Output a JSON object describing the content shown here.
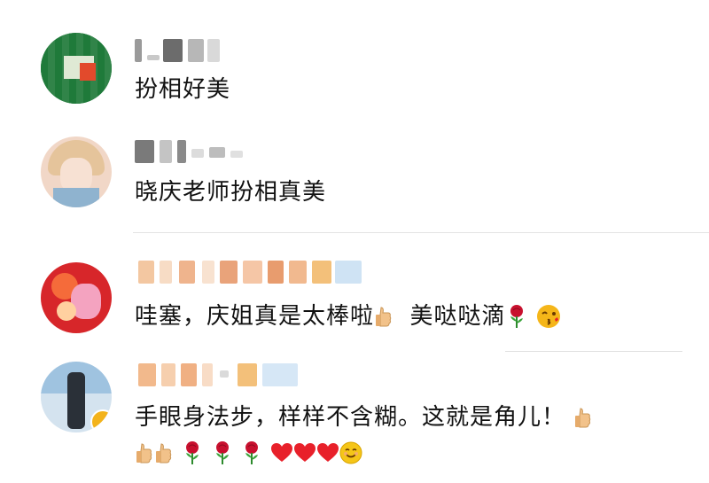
{
  "comments": [
    {
      "id": "c1",
      "name_masked": "",
      "text": "扮相好美",
      "avatar_icon": "green-avatar"
    },
    {
      "id": "c2",
      "name_masked": "",
      "text": "晓庆老师扮相真美",
      "avatar_icon": "girl-avatar"
    },
    {
      "id": "c3",
      "name_masked": "",
      "text_parts": [
        "哇塞，庆姐真是太棒啦",
        "美哒哒滴"
      ],
      "avatar_icon": "red-flower-avatar"
    },
    {
      "id": "c4",
      "name_masked": "",
      "text_parts": [
        "手眼身法步，样样不含糊。这就是角儿！"
      ],
      "avatar_icon": "man-sky-avatar"
    }
  ],
  "colors": {
    "text": "#111111",
    "divider": "#e4e4e4",
    "heart": "#e8202a",
    "thumb": "#f2c28a",
    "rose": "#c8102e"
  }
}
